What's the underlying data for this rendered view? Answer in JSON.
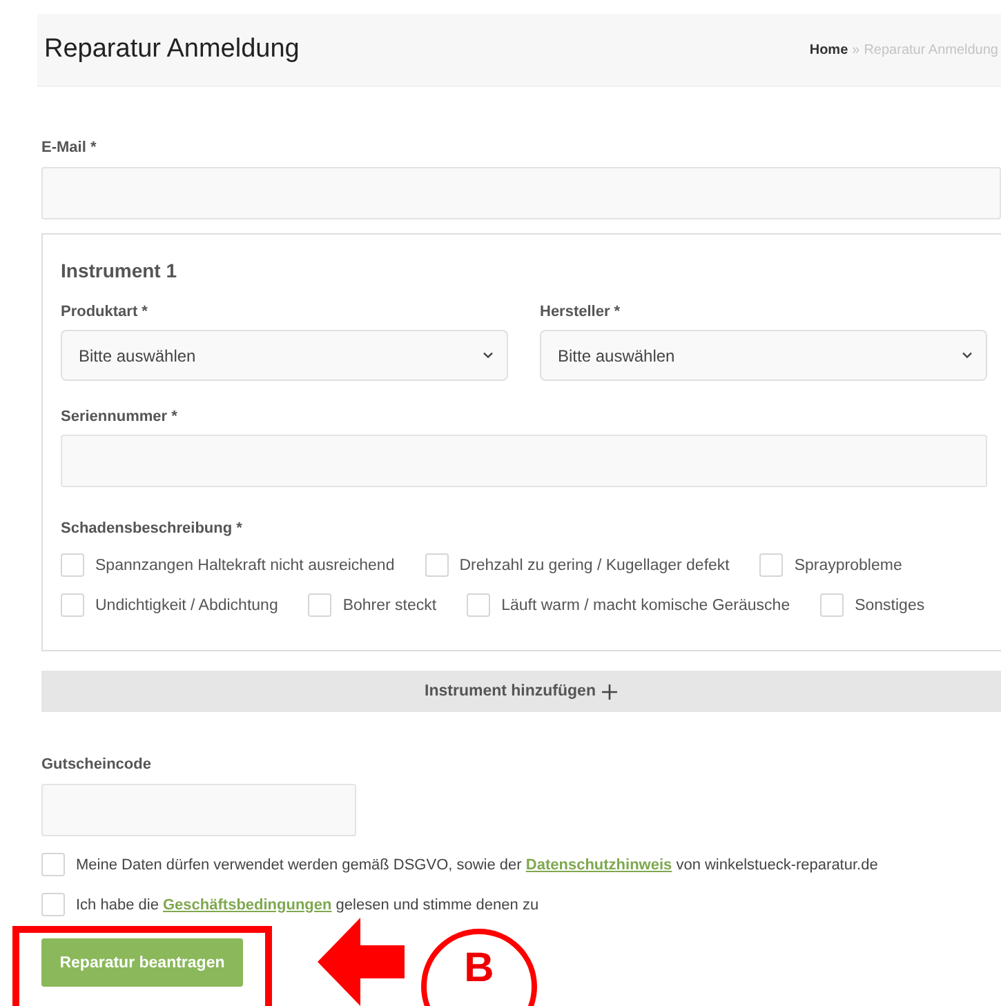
{
  "header": {
    "title": "Reparatur Anmeldung",
    "breadcrumb": {
      "home": "Home",
      "separator": "»",
      "current": "Reparatur Anmeldung"
    }
  },
  "email": {
    "label": "E-Mail *"
  },
  "instrument": {
    "title": "Instrument 1",
    "selects": [
      {
        "label": "Produktart *",
        "value": "Bitte auswählen"
      },
      {
        "label": "Hersteller *",
        "value": "Bitte auswählen"
      }
    ],
    "serial": {
      "label": "Seriennummer *"
    },
    "damage": {
      "label": "Schadensbeschreibung *",
      "options": [
        {
          "label": "Spannzangen Haltekraft nicht ausreichend",
          "checked": false
        },
        {
          "label": "Drehzahl zu gering / Kugellager defekt",
          "checked": false
        },
        {
          "label": "Sprayprobleme",
          "checked": false
        },
        {
          "label": "Undichtigkeit / Abdichtung",
          "checked": false
        },
        {
          "label": "Bohrer steckt",
          "checked": false
        },
        {
          "label": "Läuft warm / macht komische Geräusche",
          "checked": false
        },
        {
          "label": "Sonstiges",
          "checked": false
        }
      ]
    }
  },
  "add_button": {
    "label": "Instrument hinzufügen"
  },
  "voucher": {
    "label": "Gutscheincode"
  },
  "consents": [
    {
      "checked": false,
      "before": "Meine Daten dürfen verwendet werden gemäß DSGVO, sowie der",
      "link": "Datenschutzhinweis",
      "after": "von winkelstueck-reparatur.de"
    },
    {
      "checked": false,
      "before": "Ich habe die",
      "link": "Geschäftsbedingungen",
      "after": "gelesen und stimme denen zu"
    }
  ],
  "submit": {
    "label": "Reparatur beantragen"
  },
  "annotation": {
    "label": "B"
  }
}
